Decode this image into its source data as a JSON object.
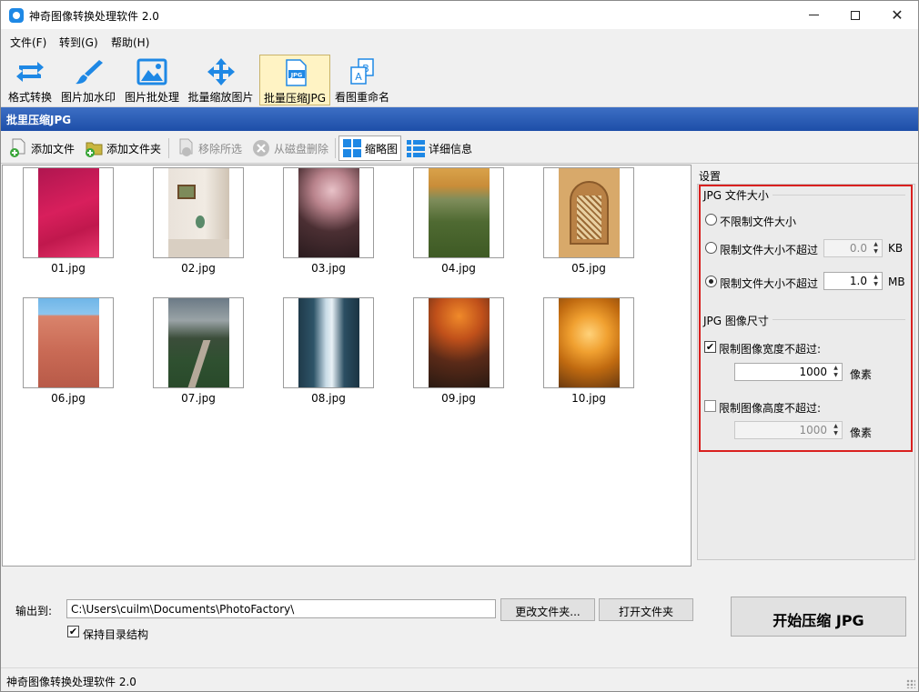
{
  "window": {
    "title": "神奇图像转换处理软件 2.0",
    "minimize": "–",
    "maximize": "□",
    "close": "✕"
  },
  "menu": [
    "文件(F)",
    "转到(G)",
    "帮助(H)"
  ],
  "toolbar": [
    {
      "label": "格式转换",
      "icon": "rotate-arrows-icon"
    },
    {
      "label": "图片加水印",
      "icon": "brush-icon"
    },
    {
      "label": "图片批处理",
      "icon": "picture-icon"
    },
    {
      "label": "批量缩放图片",
      "icon": "move-arrows-icon"
    },
    {
      "label": "批量压缩JPG",
      "icon": "jpg-file-icon",
      "active": true
    },
    {
      "label": "看图重命名",
      "icon": "rename-ab-icon"
    }
  ],
  "section_title": "批里压缩JPG",
  "subtoolbar": {
    "add_file": "添加文件",
    "add_folder": "添加文件夹",
    "remove_selected": "移除所选",
    "delete_from_disk": "从磁盘删除",
    "thumbnail_view": "缩略图",
    "detail_view": "详细信息"
  },
  "thumbnails": [
    "01.jpg",
    "02.jpg",
    "03.jpg",
    "04.jpg",
    "05.jpg",
    "06.jpg",
    "07.jpg",
    "08.jpg",
    "09.jpg",
    "10.jpg"
  ],
  "settings": {
    "title": "设置",
    "size_group": "JPG 文件大小",
    "opt_no_limit": "不限制文件大小",
    "opt_limit_kb": "限制文件大小不超过",
    "kb_value": "0.0",
    "kb_unit": "KB",
    "opt_limit_mb": "限制文件大小不超过",
    "mb_value": "1.0",
    "mb_unit": "MB",
    "dim_group": "JPG 图像尺寸",
    "limit_width": "限制图像宽度不超过:",
    "width_value": "1000",
    "width_unit": "像素",
    "limit_height": "限制图像高度不超过:",
    "height_value": "1000",
    "height_unit": "像素"
  },
  "output": {
    "label": "输出到:",
    "path": "C:\\Users\\cuilm\\Documents\\PhotoFactory\\",
    "change_folder": "更改文件夹...",
    "open_folder": "打开文件夹",
    "keep_structure": "保持目录结构",
    "start": "开始压缩 JPG"
  },
  "status": "神奇图像转换处理软件 2.0",
  "colors": {
    "accent": "#1e88e5",
    "section_bar": "#1d4ea8",
    "highlight_box": "#d9201f",
    "active_tool": "#fff3c4"
  }
}
